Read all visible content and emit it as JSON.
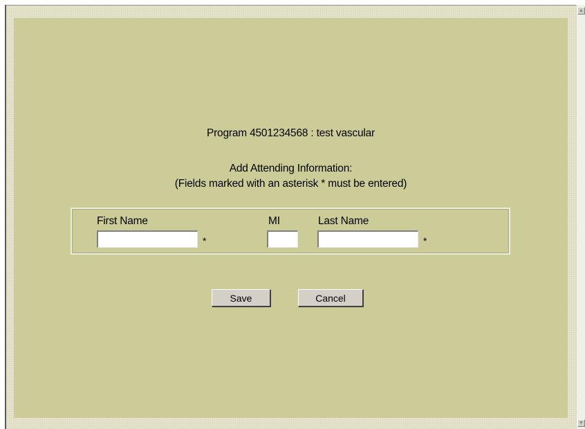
{
  "program": {
    "title": "Program 4501234568 : test vascular"
  },
  "form": {
    "heading": "Add Attending Information:",
    "note": "(Fields marked with an asterisk * must be entered)",
    "first_name": {
      "label": "First Name",
      "value": "",
      "required_marker": "*"
    },
    "middle_initial": {
      "label": "MI",
      "value": ""
    },
    "last_name": {
      "label": "Last Name",
      "value": "",
      "required_marker": "*"
    }
  },
  "actions": {
    "save_label": "Save",
    "cancel_label": "Cancel"
  },
  "scrollbar": {
    "up_icon": "scroll-up-arrow-icon",
    "down_icon": "scroll-down-arrow-icon"
  },
  "colors": {
    "panel_background": "#cccc99",
    "border_texture": "#ecebd8",
    "button_face": "#d4d0c8"
  }
}
